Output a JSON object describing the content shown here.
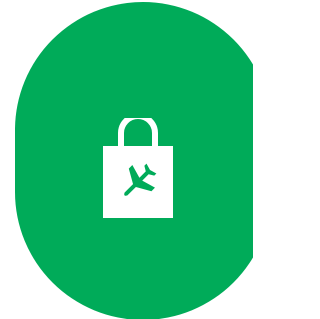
{
  "app_icon": {
    "icon": "travel-shopping-bag-icon",
    "overlay_icon": "airplane-icon",
    "background_color": "#00ab59",
    "icon_color": "#ffffff"
  }
}
